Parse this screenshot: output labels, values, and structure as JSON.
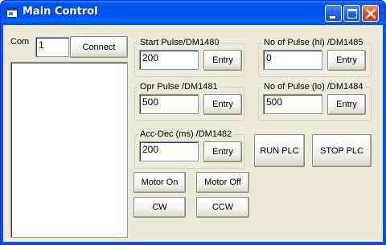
{
  "window": {
    "title": "Main Control"
  },
  "com": {
    "label": "Com",
    "value": "1",
    "connect_label": "Connect"
  },
  "fields": [
    {
      "title": "Start Pulse/DM1480",
      "value": "200",
      "button": "Entry"
    },
    {
      "title": "No of Pulse (hi) /DM1485",
      "value": "0",
      "button": "Entry"
    },
    {
      "title": "Opr Pulse /DM1481",
      "value": "500",
      "button": "Entry"
    },
    {
      "title": "No of Pulse (lo) /DM1484",
      "value": "500",
      "button": "Entry"
    },
    {
      "title": "Acc-Dec (ms) /DM1482",
      "value": "200",
      "button": "Entry"
    }
  ],
  "buttons": {
    "run_plc": "RUN PLC",
    "stop_plc": "STOP PLC",
    "motor_on": "Motor On",
    "motor_off": "Motor Off",
    "cw": "CW",
    "ccw": "CCW"
  }
}
